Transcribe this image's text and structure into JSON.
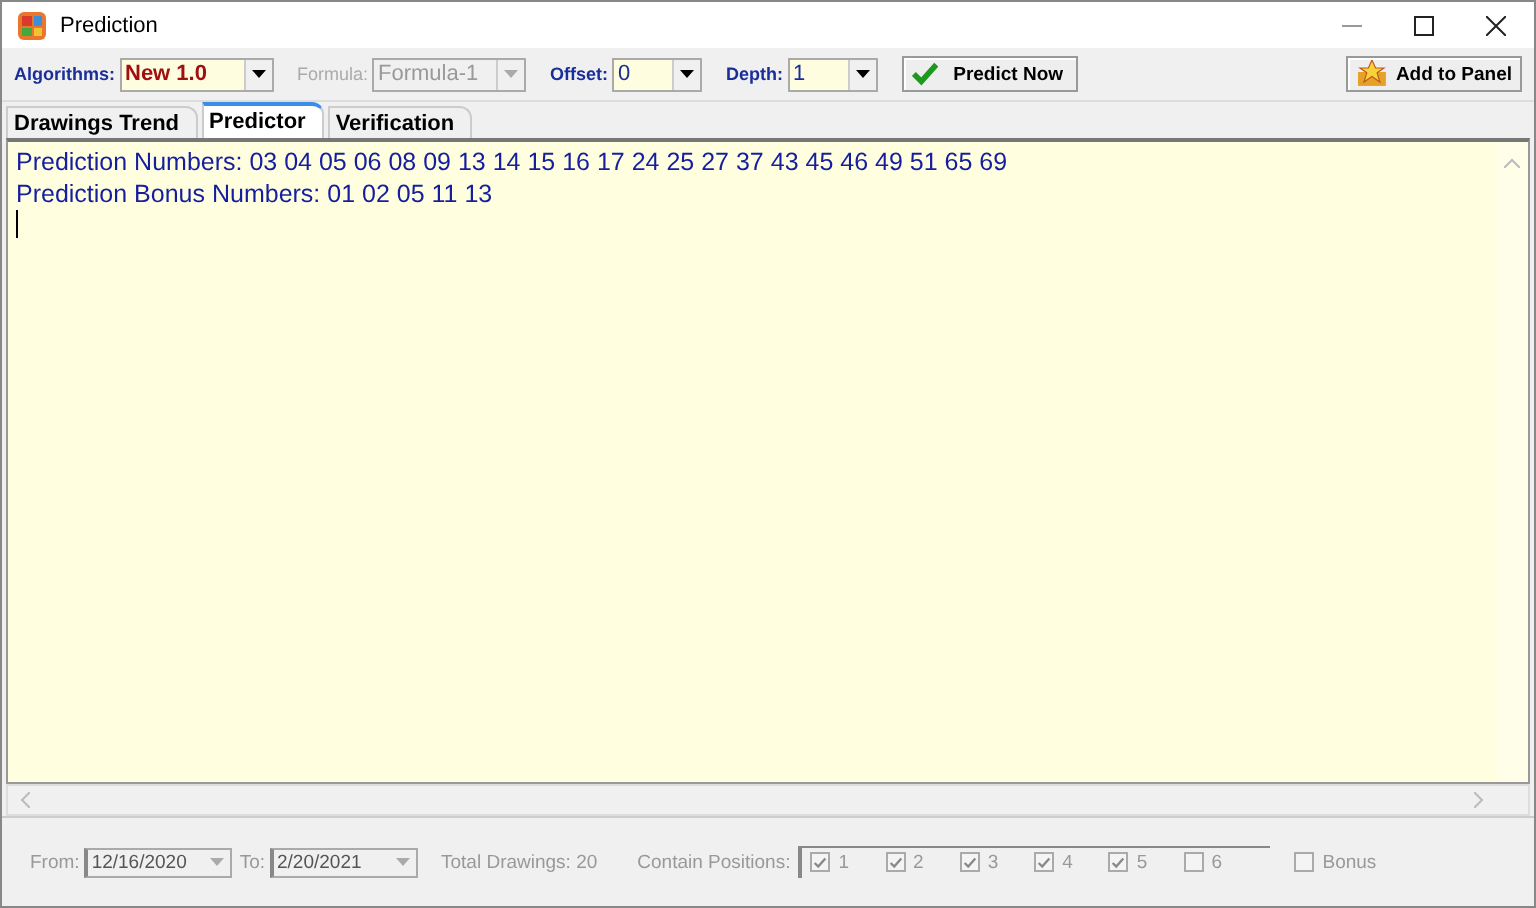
{
  "window": {
    "title": "Prediction"
  },
  "toolbar": {
    "combos": [
      {
        "label": "Algorithms:",
        "value": "New 1.0",
        "disabled": false,
        "kind": "wide"
      },
      {
        "label": "Formula:",
        "value": "Formula-1",
        "disabled": true,
        "kind": "wide"
      },
      {
        "label": "Offset:",
        "value": "0",
        "disabled": false,
        "kind": "narrow"
      },
      {
        "label": "Depth:",
        "value": "1",
        "disabled": false,
        "kind": "narrow"
      }
    ],
    "predict_button": "Predict Now",
    "add_button": "Add to Panel"
  },
  "tabs": [
    {
      "label": "Drawings Trend",
      "selected": false
    },
    {
      "label": "Predictor",
      "selected": true
    },
    {
      "label": "Verification",
      "selected": false
    }
  ],
  "output": {
    "lines": [
      "Prediction Numbers: 03 04 05 06 08 09 13 14 15 16 17 24 25 27 37 43 45 46 49 51 65 69",
      "Prediction Bonus Numbers: 01 02 05 11 13"
    ]
  },
  "filter": {
    "disabled": true,
    "from": {
      "label": "From:",
      "value": "12/16/2020"
    },
    "to": {
      "label": "To:",
      "value": "2/20/2021"
    },
    "total": "Total Drawings: 20",
    "positions": {
      "label": "Contain Positions:",
      "items": [
        {
          "label": "1",
          "checked": true
        },
        {
          "label": "2",
          "checked": true
        },
        {
          "label": "3",
          "checked": true
        },
        {
          "label": "4",
          "checked": true
        },
        {
          "label": "5",
          "checked": true
        },
        {
          "label": "6",
          "checked": false
        }
      ]
    },
    "bonus": {
      "label": "Bonus",
      "checked": false
    }
  }
}
